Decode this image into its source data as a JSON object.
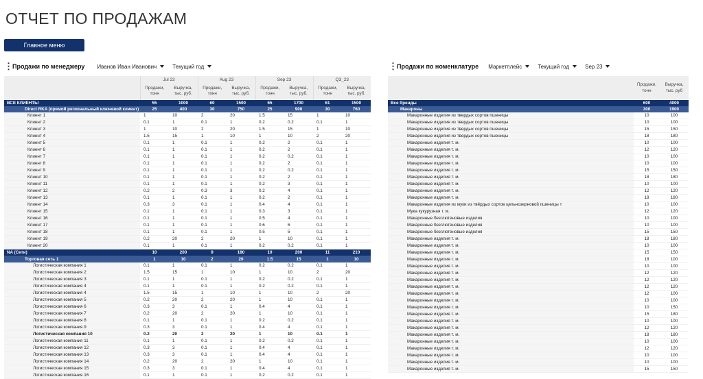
{
  "title": "ОТЧЕТ ПО ПРОДАЖАМ",
  "menu_button": "Главное меню",
  "left_controls": {
    "section": "Продажи по менеджеру",
    "manager": "Иванов Иван Иванович",
    "period": "Текущий год"
  },
  "right_controls": {
    "section": "Продажи по номенклатуре",
    "channel": "Маркетплейс",
    "period": "Текущий год",
    "month": "Sep 23"
  },
  "left_table": {
    "months": [
      "Jul 23",
      "Aug 23",
      "Sep 23",
      "Q3_23"
    ],
    "sub_qty": "Продажи, тонн",
    "sub_rev": "Выручка, тыс. руб.",
    "rows": [
      {
        "l": "ВСЕ КЛИЕНТЫ",
        "t": "r1",
        "v": [
          "55",
          "1000",
          "60",
          "1500",
          "65",
          "1700",
          "61",
          "1500"
        ]
      },
      {
        "l": "Direct RKA (прямой региональный ключевой клиент)",
        "t": "r2",
        "v": [
          "25",
          "400",
          "30",
          "750",
          "25",
          "900",
          "30",
          "760"
        ]
      },
      {
        "l": "Клиент 1",
        "t": "r3",
        "v": [
          "1",
          "10",
          "2",
          "20",
          "1.5",
          "15",
          "1",
          "10"
        ]
      },
      {
        "l": "Клиент 2",
        "t": "r3",
        "v": [
          "0.1",
          "1",
          "0.1",
          "1",
          "0.2",
          "0.2",
          "0.1",
          "1"
        ]
      },
      {
        "l": "Клиент 3",
        "t": "r3",
        "v": [
          "1",
          "10",
          "2",
          "20",
          "1.5",
          "15",
          "1",
          "10"
        ]
      },
      {
        "l": "Клиент 4",
        "t": "r3",
        "v": [
          "1.5",
          "15",
          "1",
          "10",
          "1",
          "10",
          "2",
          "20"
        ]
      },
      {
        "l": "Клиент 5",
        "t": "r3",
        "v": [
          "0.1",
          "1",
          "0.1",
          "1",
          "0.2",
          "2",
          "0.1",
          "1"
        ]
      },
      {
        "l": "Клиент 6",
        "t": "r3",
        "v": [
          "0.1",
          "1",
          "0.1",
          "1",
          "0.2",
          "2",
          "0.1",
          "1"
        ]
      },
      {
        "l": "Клиент 7",
        "t": "r3",
        "v": [
          "0.1",
          "1",
          "0.1",
          "1",
          "0.2",
          "0.2",
          "0.1",
          "1"
        ]
      },
      {
        "l": "Клиент 8",
        "t": "r3",
        "v": [
          "0.1",
          "1",
          "0.1",
          "1",
          "0.2",
          "2",
          "0.1",
          "1"
        ]
      },
      {
        "l": "Клиент 9",
        "t": "r3",
        "v": [
          "0.1",
          "1",
          "0.1",
          "1",
          "0.2",
          "0.2",
          "0.1",
          "1"
        ]
      },
      {
        "l": "Клиент 10",
        "t": "r3",
        "v": [
          "0.1",
          "1",
          "0.1",
          "1",
          "0.2",
          "2",
          "0.1",
          "1"
        ]
      },
      {
        "l": "Клиент 11",
        "t": "r3",
        "v": [
          "0.1",
          "1",
          "0.1",
          "1",
          "0.2",
          "3",
          "0.1",
          "1"
        ]
      },
      {
        "l": "Клиент 12",
        "t": "r3",
        "v": [
          "0.2",
          "2",
          "0.3",
          "3",
          "0.2",
          "4",
          "0.1",
          "1"
        ]
      },
      {
        "l": "Клиент 13",
        "t": "r3",
        "v": [
          "0.1",
          "1",
          "0.1",
          "1",
          "0.2",
          "2",
          "0.1",
          "1"
        ]
      },
      {
        "l": "Клиент 14",
        "t": "r3",
        "v": [
          "0.3",
          "3",
          "0.1",
          "1",
          "0.4",
          "4",
          "0.1",
          "1"
        ]
      },
      {
        "l": "Клиент 15",
        "t": "r3",
        "v": [
          "0.1",
          "1",
          "0.1",
          "1",
          "0.3",
          "3",
          "0.1",
          "1"
        ]
      },
      {
        "l": "Клиент 16",
        "t": "r3",
        "v": [
          "0.1",
          "1",
          "0.1",
          "1",
          "0.5",
          "4",
          "0.1",
          "1"
        ]
      },
      {
        "l": "Клиент 17",
        "t": "r3",
        "v": [
          "0.1",
          "1",
          "0.1",
          "1",
          "0.6",
          "6",
          "0.1",
          "1"
        ]
      },
      {
        "l": "Клиент 18",
        "t": "r3",
        "v": [
          "0.1",
          "1",
          "0.1",
          "1",
          "0.5",
          "5",
          "0.1",
          "1"
        ]
      },
      {
        "l": "Клиент 19",
        "t": "r3",
        "v": [
          "0.2",
          "20",
          "2",
          "20",
          "1",
          "10",
          "0.1",
          "1"
        ]
      },
      {
        "l": "Клиент 20",
        "t": "r3",
        "v": [
          "0.1",
          "1",
          "0.1",
          "1",
          "0.2",
          "0.2",
          "0.1",
          "1"
        ]
      },
      {
        "l": "NA (Сети)",
        "t": "r1",
        "v": [
          "10",
          "200",
          "9",
          "180",
          "10",
          "200",
          "11",
          "210"
        ]
      },
      {
        "l": "Торговая сеть 1",
        "t": "r2",
        "v": [
          "1",
          "10",
          "2",
          "20",
          "1.5",
          "15",
          "1",
          "10"
        ]
      },
      {
        "l": "Логистическая компания 1",
        "t": "r4",
        "v": [
          "0.1",
          "1",
          "0.1",
          "1",
          "0.2",
          "0.2",
          "0.1",
          "1"
        ]
      },
      {
        "l": "Логистическая компания 2",
        "t": "r4",
        "v": [
          "1.5",
          "15",
          "1",
          "10",
          "1",
          "10",
          "2",
          "20"
        ]
      },
      {
        "l": "Логистическая компания 3",
        "t": "r4",
        "v": [
          "0.1",
          "1",
          "0.1",
          "1",
          "0.2",
          "0.2",
          "0.1",
          "1"
        ]
      },
      {
        "l": "Логистическая компания 4",
        "t": "r4",
        "v": [
          "0.1",
          "1",
          "0.1",
          "1",
          "0.2",
          "0.2",
          "0.1",
          "1"
        ]
      },
      {
        "l": "Логистическая компания 4",
        "t": "r4",
        "v": [
          "1.5",
          "15",
          "1",
          "10",
          "1",
          "10",
          "2",
          "20"
        ]
      },
      {
        "l": "Логистическая компания 5",
        "t": "r4",
        "v": [
          "0.2",
          "20",
          "2",
          "20",
          "1",
          "10",
          "0.1",
          "1"
        ]
      },
      {
        "l": "Логистическая компания 6",
        "t": "r4",
        "v": [
          "0.3",
          "3",
          "0.1",
          "1",
          "0.4",
          "4",
          "0.1",
          "1"
        ]
      },
      {
        "l": "Логистическая компания 7",
        "t": "r4",
        "v": [
          "0.2",
          "20",
          "2",
          "20",
          "1",
          "10",
          "0.1",
          "1"
        ]
      },
      {
        "l": "Логистическая компания 8",
        "t": "r4",
        "v": [
          "0.1",
          "1",
          "0.1",
          "1",
          "0.2",
          "0.2",
          "0.1",
          "1"
        ]
      },
      {
        "l": "Логистическая компания 9",
        "t": "r4",
        "v": [
          "0.3",
          "3",
          "0.1",
          "1",
          "0.4",
          "4",
          "0.1",
          "1"
        ]
      },
      {
        "l": "Логистическая компания 10",
        "t": "r4",
        "b": true,
        "v": [
          "0.2",
          "20",
          "2",
          "20",
          "1",
          "10",
          "0.1",
          "1"
        ]
      },
      {
        "l": "Логистическая компания 11",
        "t": "r4",
        "v": [
          "0.1",
          "1",
          "0.1",
          "1",
          "0.2",
          "0.2",
          "0.1",
          "1"
        ]
      },
      {
        "l": "Логистическая компания 12",
        "t": "r4",
        "v": [
          "0.3",
          "3",
          "0.1",
          "1",
          "0.4",
          "4",
          "0.1",
          "1"
        ]
      },
      {
        "l": "Логистическая компания 13",
        "t": "r4",
        "v": [
          "0.3",
          "3",
          "0.1",
          "1",
          "0.4",
          "4",
          "0.1",
          "1"
        ]
      },
      {
        "l": "Логистическая компания 14",
        "t": "r4",
        "v": [
          "0.2",
          "20",
          "2",
          "20",
          "1",
          "10",
          "0.1",
          "1"
        ]
      },
      {
        "l": "Логистическая компания 15",
        "t": "r4",
        "v": [
          "0.3",
          "3",
          "0.1",
          "1",
          "0.4",
          "4",
          "0.1",
          "1"
        ]
      },
      {
        "l": "Логистическая компания 16",
        "t": "r4",
        "v": [
          "0.1",
          "1",
          "0.1",
          "1",
          "0.2",
          "0.2",
          "0.1",
          "1"
        ]
      }
    ]
  },
  "right_table": {
    "sub_qty": "Продажи, тонн",
    "sub_rev": "Выручка, тыс. руб",
    "rows": [
      {
        "l": "Все бренды",
        "t": "r1",
        "v": [
          "600",
          "4000"
        ]
      },
      {
        "l": "Макароны",
        "t": "r2",
        "v": [
          "300",
          "1900"
        ]
      },
      {
        "l": "Макаронные изделия из твердых сортов пшеницы",
        "t": "r3",
        "v": [
          "10",
          "100"
        ]
      },
      {
        "l": "Макаронные изделия из твердых сортов пшеницы",
        "t": "r3",
        "v": [
          "10",
          "100"
        ]
      },
      {
        "l": "Макаронные изделия из твердых сортов пшеницы",
        "t": "r3",
        "v": [
          "15",
          "150"
        ]
      },
      {
        "l": "Макаронные изделия из твердых сортов пшеницы",
        "t": "r3",
        "v": [
          "18",
          "180"
        ]
      },
      {
        "l": "Макаронные изделия т. м.",
        "t": "r3",
        "v": [
          "10",
          "100"
        ]
      },
      {
        "l": "Макаронные изделия т. м.",
        "t": "r3",
        "v": [
          "12",
          "120"
        ]
      },
      {
        "l": "Макаронные изделия т. м.",
        "t": "r3",
        "v": [
          "10",
          "100"
        ]
      },
      {
        "l": "Макаронные изделия т. м.",
        "t": "r3",
        "v": [
          "10",
          "100"
        ]
      },
      {
        "l": "Макаронные изделия т. м.",
        "t": "r3",
        "v": [
          "15",
          "150"
        ]
      },
      {
        "l": "Макаронные изделия т. м.",
        "t": "r3",
        "v": [
          "18",
          "180"
        ]
      },
      {
        "l": "Макаронные изделия т. м.",
        "t": "r3",
        "v": [
          "10",
          "100"
        ]
      },
      {
        "l": "Макаронные изделия т. м.",
        "t": "r3",
        "v": [
          "12",
          "120"
        ]
      },
      {
        "l": "Макаронные изделия т. м.",
        "t": "r3",
        "v": [
          "18",
          "180"
        ]
      },
      {
        "l": "Макаронные изделия из муки из твёрдых сортов цельнозерновой пшеницы т",
        "t": "r3",
        "v": [
          "10",
          "100"
        ]
      },
      {
        "l": "Мука кукурузная т. м.",
        "t": "r3",
        "v": [
          "12",
          "120"
        ]
      },
      {
        "l": "Макаронные безглютеновые изделия",
        "t": "r3",
        "v": [
          "10",
          "100"
        ]
      },
      {
        "l": "Макаронные безглютеновые изделия",
        "t": "r3",
        "v": [
          "10",
          "100"
        ]
      },
      {
        "l": "Макаронные безглютеновые изделия",
        "t": "r3",
        "v": [
          "15",
          "150"
        ]
      },
      {
        "l": "Макаронные изделия т. м.",
        "t": "r3",
        "v": [
          "18",
          "180"
        ]
      },
      {
        "l": "Макаронные изделия т. м.",
        "t": "r3",
        "v": [
          "10",
          "100"
        ]
      },
      {
        "l": "Макаронные изделия т. м.",
        "t": "r3",
        "v": [
          "15",
          "150"
        ]
      },
      {
        "l": "Макаронные изделия т. м.",
        "t": "r3",
        "v": [
          "18",
          "100"
        ]
      },
      {
        "l": "Макаронные изделия т. м.",
        "t": "r3",
        "v": [
          "10",
          "100"
        ]
      },
      {
        "l": "Макаронные изделия т. м.",
        "t": "r3",
        "v": [
          "12",
          "120"
        ]
      },
      {
        "l": "Макаронные изделия т. м.",
        "t": "r3",
        "v": [
          "12",
          "120"
        ]
      },
      {
        "l": "Макаронные изделия т. м.",
        "t": "r3",
        "v": [
          "12",
          "120"
        ]
      },
      {
        "l": "Макаронные изделия т. м.",
        "t": "r3",
        "v": [
          "12",
          "100"
        ]
      },
      {
        "l": "Макаронные изделия т. м.",
        "t": "r3",
        "v": [
          "10",
          "100"
        ]
      },
      {
        "l": "Макаронные изделия т. м.",
        "t": "r3",
        "v": [
          "10",
          "150"
        ]
      },
      {
        "l": "Макаронные изделия т. м.",
        "t": "r3",
        "v": [
          "15",
          "180"
        ]
      },
      {
        "l": "Макаронные изделия т. м.",
        "t": "r3",
        "v": [
          "10",
          "100"
        ]
      },
      {
        "l": "Макаронные изделия т. м.",
        "t": "r3",
        "v": [
          "12",
          "120"
        ]
      },
      {
        "l": "Макаронные изделия т. м.",
        "t": "r3",
        "v": [
          "18",
          "180"
        ]
      },
      {
        "l": "Макаронные изделия т. м.",
        "t": "r3",
        "v": [
          "10",
          "100"
        ]
      },
      {
        "l": "Макаронные изделия т. м.",
        "t": "r3",
        "v": [
          "12",
          "120"
        ]
      },
      {
        "l": "Макаронные изделия т. м.",
        "t": "r3",
        "v": [
          "10",
          "100"
        ]
      },
      {
        "l": "Макаронные изделия т. м.",
        "t": "r3",
        "v": [
          "10",
          "100"
        ]
      },
      {
        "l": "Макаронные изделия т. м.",
        "t": "r3",
        "v": [
          "15",
          "150"
        ]
      }
    ]
  }
}
